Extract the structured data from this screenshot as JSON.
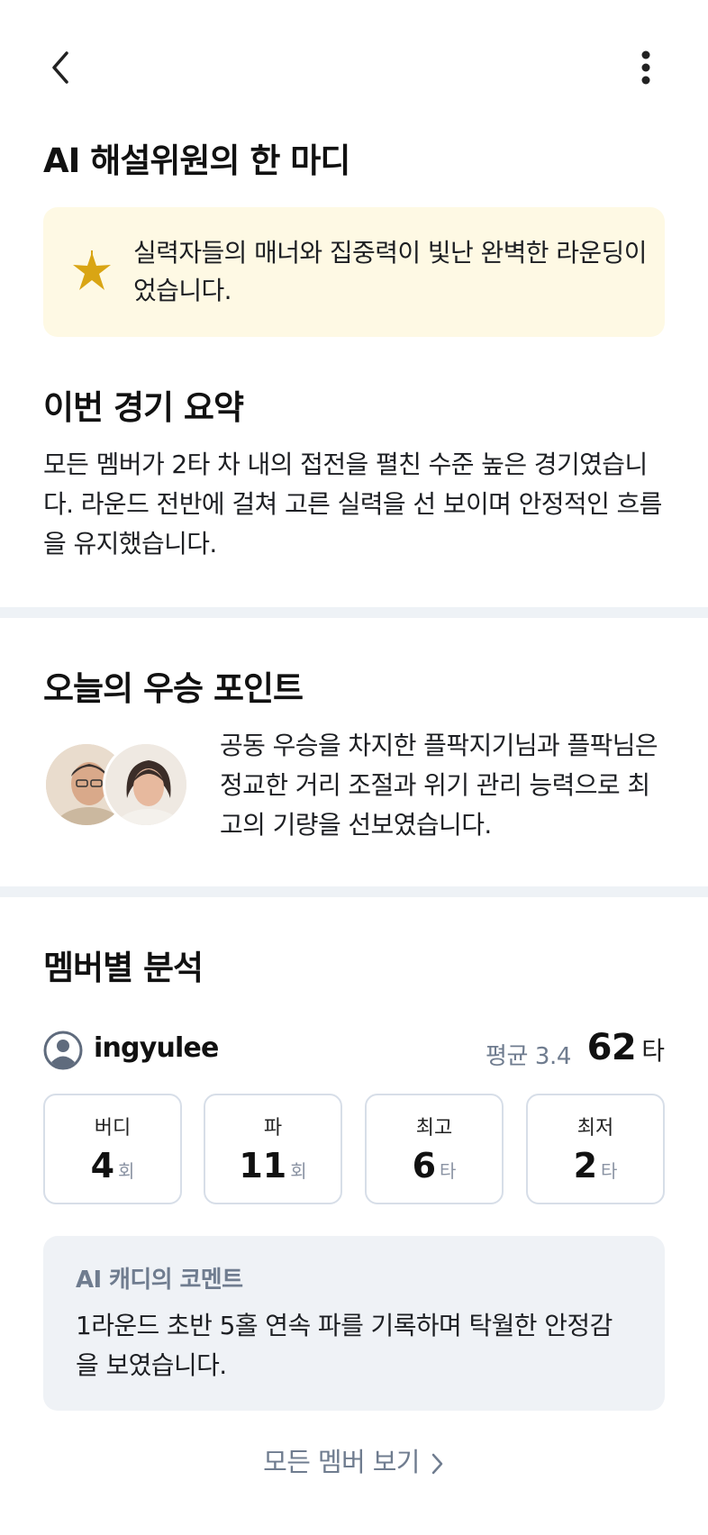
{
  "header": {
    "back_icon": "chevron-left-icon",
    "more_icon": "more-vertical-icon"
  },
  "ai_commentator": {
    "title": "AI 해설위원의 한 마디",
    "icon": "sparkle-star-icon",
    "accent_color": "#d9a514",
    "text": "실력자들의 매너와 집중력이 빛난 완벽한 라운딩이었습니다."
  },
  "summary": {
    "title": "이번 경기 요약",
    "text": "모든 멤버가 2타 차 내의 접전을 펼친 수준 높은 경기였습니다. 라운드 전반에 걸쳐 고른 실력을 선 보이며 안정적인 흐름을 유지했습니다."
  },
  "winning_point": {
    "title": "오늘의 우승 포인트",
    "text": "공동 우승을 차지한 플팍지기님과 플팍님은 정교한 거리 조절과 위기 관리 능력으로 최고의 기량을 선보였습니다."
  },
  "member_analysis": {
    "title": "멤버별 분석",
    "member": {
      "icon": "user-circle-icon",
      "name": "ingyulee",
      "avg_label": "평균 3.4",
      "total": "62",
      "total_unit": "타"
    },
    "stats": [
      {
        "label": "버디",
        "value": "4",
        "unit": "회"
      },
      {
        "label": "파",
        "value": "11",
        "unit": "회"
      },
      {
        "label": "최고",
        "value": "6",
        "unit": "타"
      },
      {
        "label": "최저",
        "value": "2",
        "unit": "타"
      }
    ],
    "caddie": {
      "title": "AI 캐디의 코멘트",
      "text": "1라운드 초반 5홀 연속 파를 기록하며 탁월한 안정감을 보였습니다."
    }
  },
  "see_all": {
    "label": "모든 멤버 보기",
    "icon": "chevron-right-icon"
  }
}
